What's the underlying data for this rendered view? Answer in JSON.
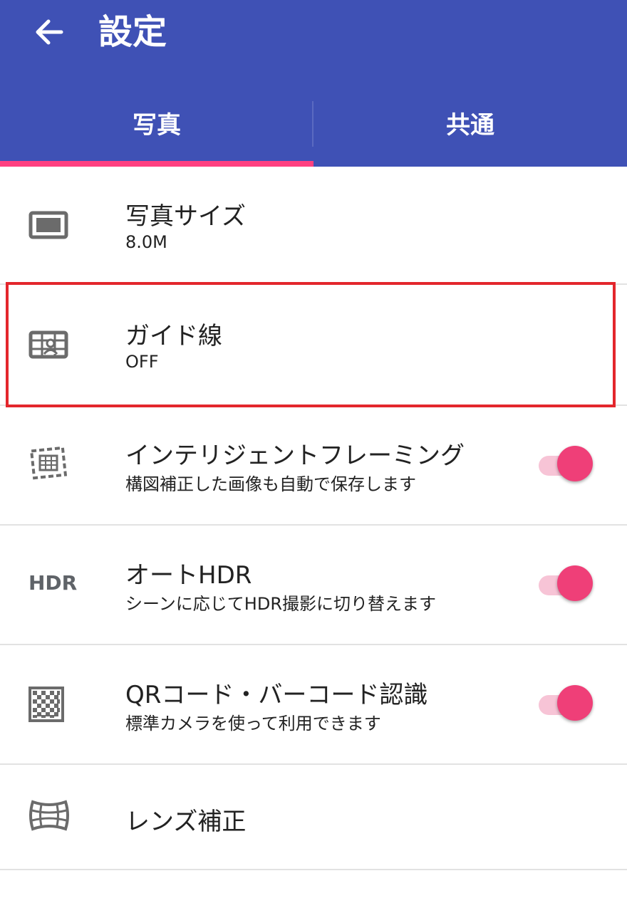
{
  "header": {
    "title": "設定",
    "back_icon": "arrow-left-icon"
  },
  "tabs": [
    {
      "label": "写真",
      "selected": true
    },
    {
      "label": "共通",
      "selected": false
    }
  ],
  "colors": {
    "appbar": "#3f51b5",
    "indicator": "#ff4081",
    "toggle_on": "#ef3f78",
    "highlight": "#e3262c"
  },
  "settings": [
    {
      "title": "写真サイズ",
      "subtitle": "8.0M",
      "icon": "photo-size-icon"
    },
    {
      "title": "ガイド線",
      "subtitle": "OFF",
      "icon": "guide-lines-icon",
      "highlighted": true
    },
    {
      "title": "インテリジェントフレーミング",
      "subtitle": "構図補正した画像も自動で保存します",
      "icon": "framing-icon",
      "toggle": true
    },
    {
      "title": "オートHDR",
      "subtitle": "シーンに応じてHDR撮影に切り替えます",
      "icon": "hdr-icon",
      "icon_text": "HDR",
      "toggle": true
    },
    {
      "title": "QRコード・バーコード認識",
      "subtitle": "標準カメラを使って利用できます",
      "icon": "qr-code-icon",
      "toggle": true
    },
    {
      "title": "レンズ補正",
      "icon": "lens-correction-icon"
    }
  ]
}
